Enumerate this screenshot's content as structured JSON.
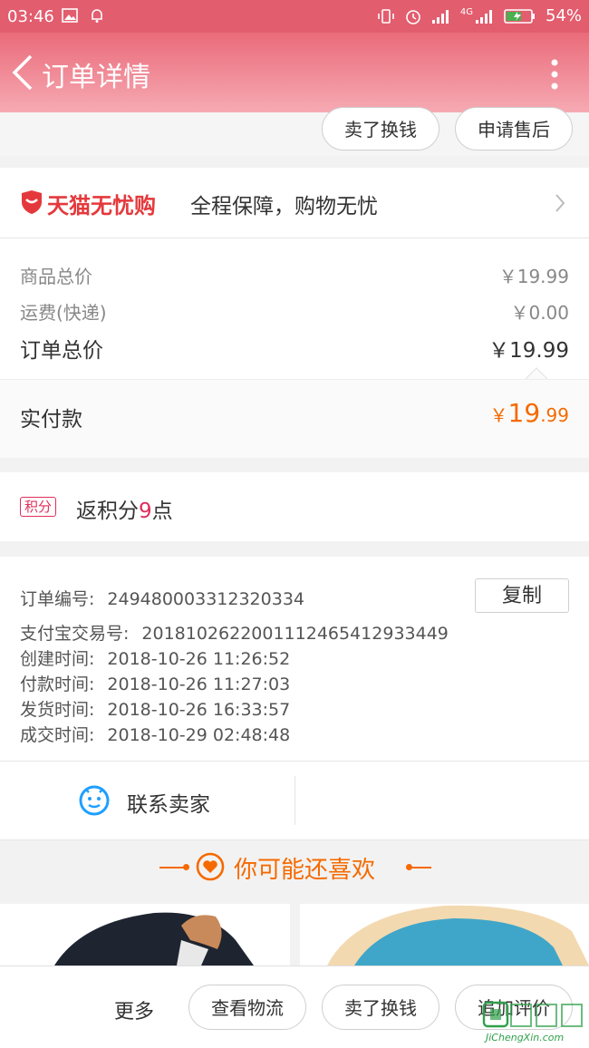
{
  "status_bar": {
    "time": "03:46",
    "battery": "54%",
    "network": "4G"
  },
  "nav": {
    "title": "订单详情",
    "back_icon": "chevron-left-icon",
    "more_icon": "more-vertical-icon"
  },
  "top_actions": {
    "sell_label": "卖了换钱",
    "after_sale_label": "申请售后"
  },
  "guarantee": {
    "brand": "天猫无忧购",
    "tagline": "全程保障，购物无忧"
  },
  "price": {
    "goods_total_label": "商品总价",
    "goods_total_value": "￥19.99",
    "shipping_label": "运费(快递)",
    "shipping_value": "￥0.00",
    "order_total_label": "订单总价",
    "order_total_value": "￥19.99",
    "paid_label": "实付款",
    "paid_currency": "￥",
    "paid_int": "19",
    "paid_dec": ".99"
  },
  "points": {
    "badge": "积分",
    "text_prefix": "返积分",
    "amount": "9",
    "text_suffix": "点"
  },
  "order_info": {
    "copy_label": "复制",
    "lines": [
      {
        "label": "订单编号:",
        "value": "249480003312320334"
      },
      {
        "label": "支付宝交易号:",
        "value": "2018102622001112465412933449"
      },
      {
        "label": "创建时间:",
        "value": "2018-10-26 11:26:52"
      },
      {
        "label": "付款时间:",
        "value": "2018-10-26 11:27:03"
      },
      {
        "label": "发货时间:",
        "value": "2018-10-26 16:33:57"
      },
      {
        "label": "成交时间:",
        "value": "2018-10-29 02:48:48"
      }
    ]
  },
  "contact": {
    "label": "联系卖家"
  },
  "recommend": {
    "title": "你可能还喜欢"
  },
  "bottom_bar": {
    "more_label": "更多",
    "logistics_label": "查看物流",
    "sell_label": "卖了换钱",
    "review_label": "追加评价"
  },
  "watermark": {
    "text": "JiChengXin.com"
  },
  "colors": {
    "brand_red": "#e4393c",
    "accent_orange": "#f56a00",
    "points_red": "#e02e5b",
    "nav_pink": "#ea6b7a"
  }
}
